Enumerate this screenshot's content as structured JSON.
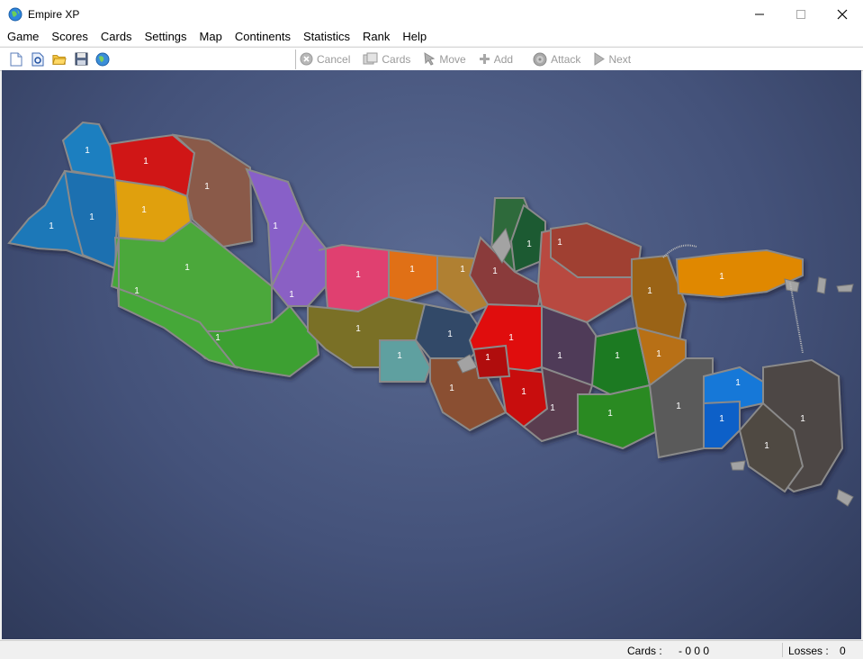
{
  "window": {
    "title": "Empire XP"
  },
  "menu": [
    "Game",
    "Scores",
    "Cards",
    "Settings",
    "Map",
    "Continents",
    "Statistics",
    "Rank",
    "Help"
  ],
  "toolbar": {
    "file_icons": [
      "new-game-icon",
      "open-scenario-icon",
      "open-folder-icon",
      "save-icon",
      "network-globe-icon"
    ],
    "actions": [
      {
        "label": "Cancel",
        "icon": "cancel-icon"
      },
      {
        "label": "Cards",
        "icon": "cards-icon"
      },
      {
        "label": "Move",
        "icon": "move-icon"
      },
      {
        "label": "Add",
        "icon": "add-icon"
      },
      {
        "label": "Attack",
        "icon": "attack-icon"
      },
      {
        "label": "Next",
        "icon": "next-icon"
      }
    ]
  },
  "territory_label": "1",
  "status": {
    "cards_label": "Cards :",
    "cards_value": "- 0 0 0",
    "losses_label": "Losses :",
    "losses_value": "0"
  },
  "colors": {
    "map_background": "#44527a",
    "land_border": "#8a8a8a",
    "island_gray": "#a3a3a3"
  }
}
